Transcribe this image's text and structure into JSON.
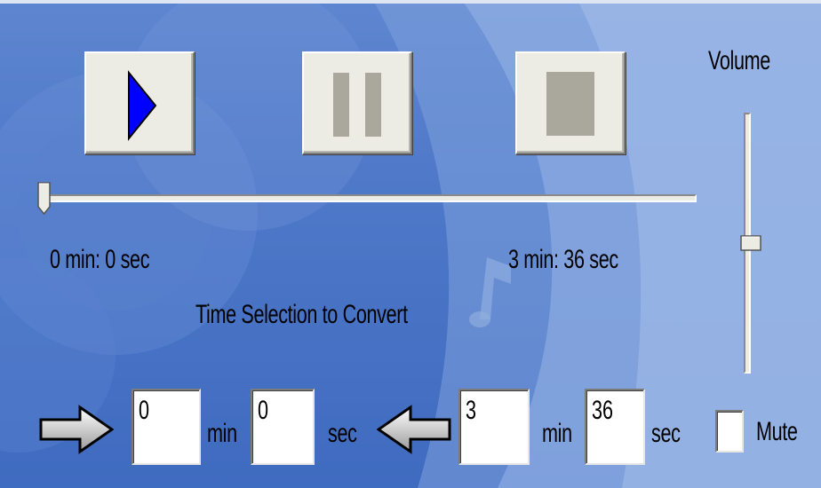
{
  "volume": {
    "label": "Volume",
    "level_fraction": 0.5
  },
  "transport": {
    "play_icon": "play-icon",
    "pause_icon": "pause-icon",
    "stop_icon": "stop-icon"
  },
  "position": {
    "start_label": "0 min: 0 sec",
    "end_label": "3 min: 36 sec",
    "position_fraction": 0
  },
  "selection": {
    "title": "Time Selection to Convert",
    "start_min": "0",
    "start_sec": "0",
    "end_min": "3",
    "end_sec": "36",
    "min_label": "min",
    "sec_label": "sec"
  },
  "mute": {
    "label": "Mute",
    "checked": false
  },
  "colors": {
    "play_triangle": "#0000ff",
    "button_face": "#ecebe4",
    "background": "#4e78c8"
  }
}
